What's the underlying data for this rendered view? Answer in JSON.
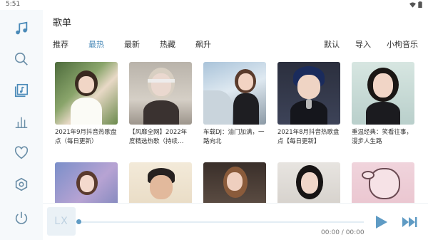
{
  "status": {
    "time": "5:51"
  },
  "sidebar": {
    "items": [
      {
        "icon": "music-note-icon"
      },
      {
        "icon": "search-icon"
      },
      {
        "icon": "playlist-icon"
      },
      {
        "icon": "leaderboard-icon"
      },
      {
        "icon": "heart-icon"
      },
      {
        "icon": "settings-icon"
      },
      {
        "icon": "power-icon"
      }
    ]
  },
  "header": {
    "title": "歌单"
  },
  "tabs": [
    "推荐",
    "最热",
    "最新",
    "热藏",
    "飙升"
  ],
  "active_tab": "最热",
  "actions": [
    "默认",
    "导入",
    "小枸音乐"
  ],
  "playlists": [
    {
      "name": "2021年9月抖音热歌盘点（每日更新）"
    },
    {
      "name": "【风靡全网】2022年度精选热歌（持续…"
    },
    {
      "name": "车载DJ：油门加满，一路向北"
    },
    {
      "name": "2021年8月抖音热歌盘点【每日更新】"
    },
    {
      "name": "重温经典：笑看往事，漫步人生路"
    },
    {
      "name": ""
    },
    {
      "name": ""
    },
    {
      "name": ""
    },
    {
      "name": ""
    },
    {
      "name": ""
    }
  ],
  "player": {
    "logo": "LX",
    "time": "00:00 / 00:00",
    "progress": 0
  },
  "colors": {
    "accent": "#4a8ab8",
    "sidebar_bg": "#f6f9fb"
  }
}
